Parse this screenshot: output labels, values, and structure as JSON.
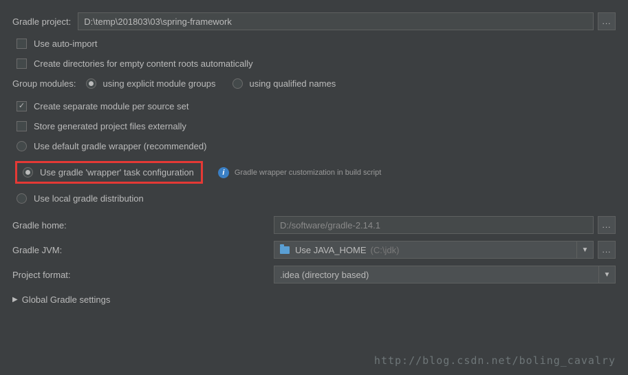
{
  "project": {
    "label": "Gradle project:",
    "path": "D:\\temp\\201803\\03\\spring-framework"
  },
  "checks": {
    "autoImport": "Use auto-import",
    "createDirs": "Create directories for empty content roots automatically",
    "separateModule": "Create separate module per source set",
    "storeExternal": "Store generated project files externally"
  },
  "group": {
    "label": "Group modules:",
    "opt1": "using explicit module groups",
    "opt2": "using qualified names"
  },
  "wrapper": {
    "defaultWrapper": "Use default gradle wrapper (recommended)",
    "taskConfig": "Use gradle 'wrapper' task configuration",
    "localDist": "Use local gradle distribution",
    "infoText": "Gradle wrapper customization in build script"
  },
  "form": {
    "gradleHomeLabel": "Gradle home:",
    "gradleHomeValue": "D:/software/gradle-2.14.1",
    "gradleJvmLabel": "Gradle JVM:",
    "gradleJvmPrefix": "Use JAVA_HOME",
    "gradleJvmPath": "(C:\\jdk)",
    "projectFormatLabel": "Project format:",
    "projectFormatValue": ".idea (directory based)"
  },
  "expander": {
    "label": "Global Gradle settings"
  },
  "ellipsis": "...",
  "watermark": "http://blog.csdn.net/boling_cavalry"
}
